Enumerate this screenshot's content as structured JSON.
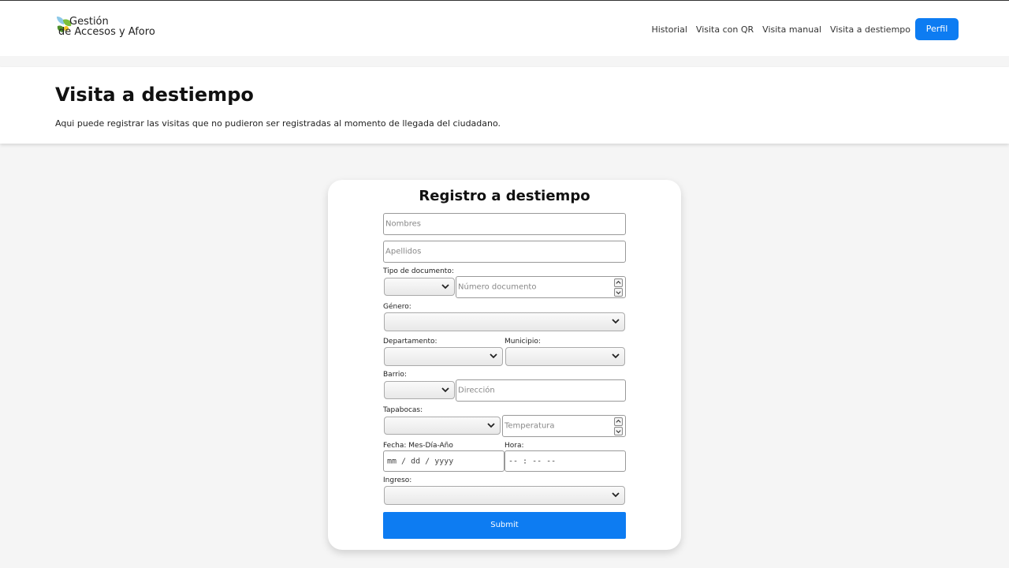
{
  "brand": {
    "line1": "Gestión",
    "line2": "de Accesos y Aforo"
  },
  "nav": {
    "items": [
      "Historial",
      "Visita con QR",
      "Visita manual",
      "Visita a destiempo"
    ],
    "profile_label": "Perfil"
  },
  "header": {
    "title": "Visita a destiempo",
    "description": "Aqui puede registrar las visitas que no pudieron ser registradas al momento de llegada del ciudadano."
  },
  "form": {
    "title": "Registro a destiempo",
    "nombres_placeholder": "Nombres",
    "apellidos_placeholder": "Apellidos",
    "tipo_documento_label": "Tipo de documento:",
    "numero_documento_placeholder": "Número documento",
    "genero_label": "Género:",
    "departamento_label": "Departamento:",
    "municipio_label": "Municipio:",
    "barrio_label": "Barrio:",
    "direccion_placeholder": "Dirección",
    "tapabocas_label": "Tapabocas:",
    "temperatura_placeholder": "Temperatura",
    "fecha_label": "Fecha: Mes-Día-Año",
    "fecha_value": "mm / dd / yyyy",
    "hora_label": "Hora:",
    "hora_value": "-- : --   --",
    "ingreso_label": "Ingreso:",
    "submit_label": "Submit"
  },
  "colors": {
    "primary": "#0d7cf2",
    "background": "#f5f5f5"
  }
}
